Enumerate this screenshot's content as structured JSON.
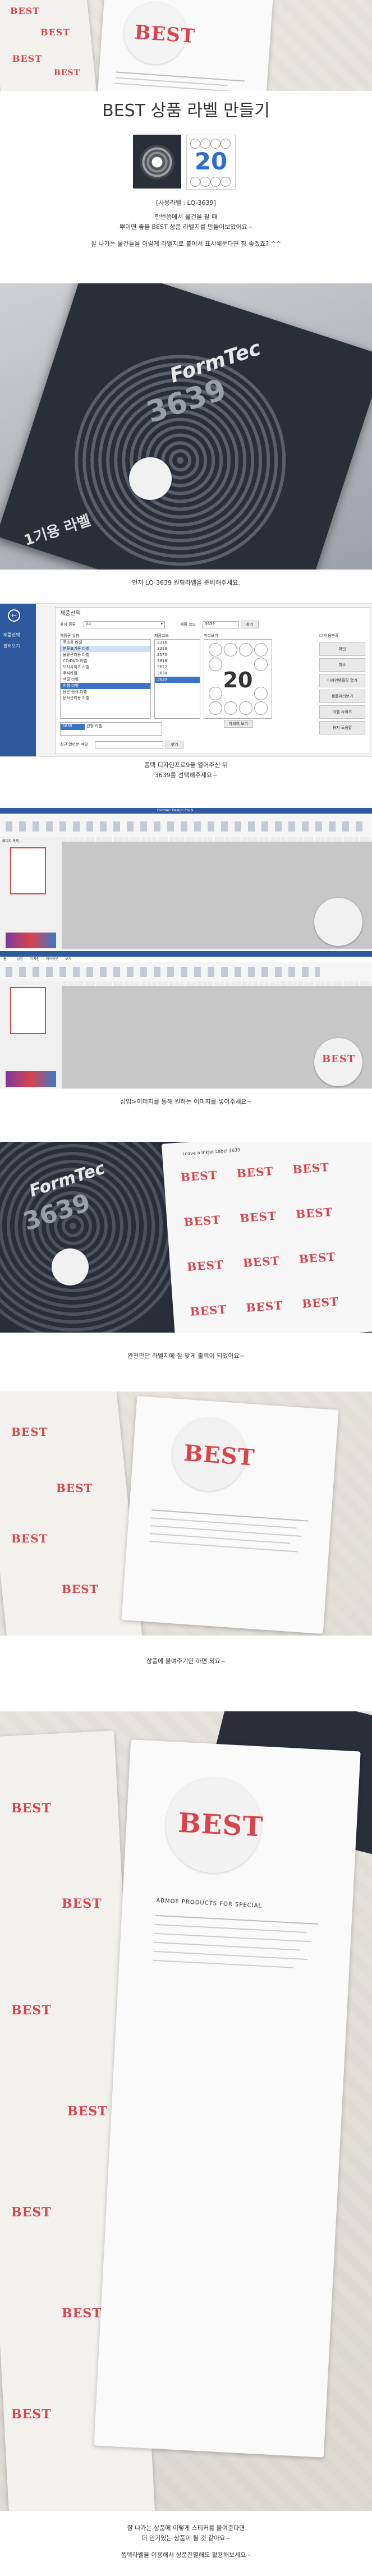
{
  "page_title": "BEST 상품 라벨 만들기",
  "product": {
    "sticker_number": "20",
    "caption_lines": [
      "[사용라벨 : LQ-3639]",
      "한번쯤에서 물건을 팔 때",
      "뿌이면 좋을 BEST 상품 라벨지를 만들어보았어요~",
      "잘 나가는 물건들을 이렇게 라벨지로 붙여서 표시해둔다면 참 좋겠죠? ^^"
    ]
  },
  "cover_photo": {
    "brand_text": "FormTec",
    "code_text": "3639",
    "korean_text": "1기용 라벨"
  },
  "step1": {
    "caption": "먼저 LQ-3639 원형라벨을 준비해주세요."
  },
  "step2": {
    "caption_lines": [
      "폼텍 디자인프로9을 열어주신 뒤",
      "3639를 선택해주세요~"
    ],
    "sidebar": {
      "back_icon": "back-arrow-icon",
      "items": [
        "제품선택",
        "불러오기"
      ]
    },
    "dialog": {
      "title": "제품선택",
      "category_label": "용지 종류",
      "category_value": "A4",
      "product_code_label": "제품 코드",
      "product_code_value": "3639",
      "search_button": "찾기",
      "list_header": "제품군 유형",
      "list_items": [
        "주소용 라벨",
        "분류표기용 라벨",
        "물류관리용 라벨",
        "CD/DVD 라벨",
        "모자사이즈 라벨",
        "주석라벨",
        "색깔 라벨",
        "원형 라벨",
        "음반 음식 라벨",
        "문서관리용 라벨"
      ],
      "selected_item": "원형 라벨",
      "code_header": "제품코드",
      "codes": [
        "3316",
        "3318",
        "3570",
        "3618",
        "3622",
        "3638",
        "3639"
      ],
      "selected_code": "3639",
      "preview_header": "미리보기",
      "preview_number": "20",
      "right_buttons": [
        "확인",
        "취소",
        "디자인템플릿 열기",
        "샘플미리보기",
        "라벨 사이즈",
        "용지 도움말"
      ],
      "detail_button": "자세히 보기",
      "recent_label": "최근 열어본 파일",
      "recent_button": "찾기",
      "table_code": "3639",
      "table_desc": "원형 라벨",
      "checkbox_label": "이용분류"
    }
  },
  "step3": {
    "title_bar": "Formtec Design Pro 9",
    "menu_tabs": [
      "홈",
      "삽입",
      "디자인",
      "레이아웃",
      "보기"
    ],
    "panel_label": "페이지 목록",
    "caption": "삽입>이미지를 통해 원하는 이미지를 넣어주세요~"
  },
  "step4": {
    "caption": "완전판단 라벨지에 잘 맞게 출력이 되었어요~",
    "sheet_title": "Leave a Inkjet Label 3639",
    "label_text": "BEST"
  },
  "step5": {
    "caption": "상품에 붙여주기만 하면 되요~"
  },
  "final": {
    "caption_lines": [
      "잘 나가는 상품에 이렇게 스티커를 붙여준다면",
      "더 인기있는 상품이 될 것 같아요~",
      "폼텍라벨을 이용해서 상품진열해도 활용해보세요~"
    ],
    "book_text": "ABMOE PRODUCTS FOR SPECIAL"
  },
  "colors": {
    "accent": "#d8434c",
    "dark_bg": "#2a2e39",
    "sky_blue": "#2f6fc8"
  }
}
